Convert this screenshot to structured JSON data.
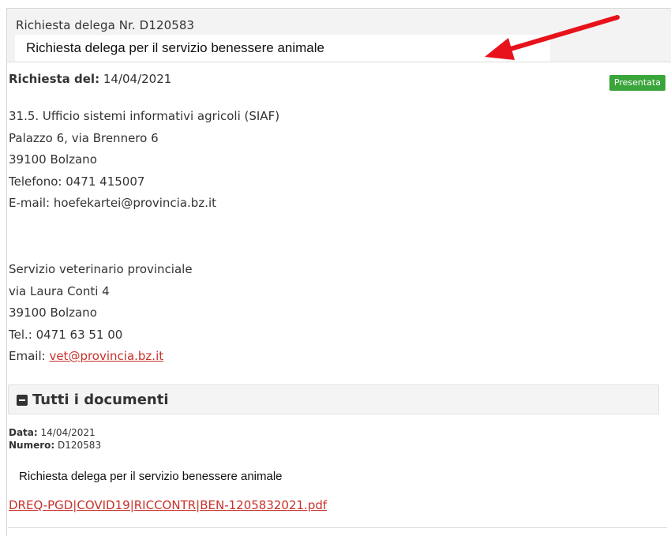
{
  "header": {
    "request_number": "Richiesta delega Nr. D120583",
    "overlay_label": "Richiesta delega per il servizio benessere animale"
  },
  "request": {
    "date_label": "Richiesta del:",
    "date_value": "14/04/2021",
    "status": "Presentata",
    "status_color": "#3aa53a"
  },
  "office1": {
    "lines": [
      "31.5. Ufficio sistemi informativi agricoli (SIAF)",
      "Palazzo 6, via Brennero 6",
      "39100 Bolzano",
      "Telefono: 0471 415007",
      "E-mail: hoefekartei@provincia.bz.it"
    ]
  },
  "office2": {
    "lines": [
      "Servizio veterinario provinciale",
      "via Laura Conti 4",
      "39100 Bolzano",
      "Tel.: 0471 63 51 00"
    ],
    "email_label": "Email:",
    "email_link": "vet@provincia.bz.it"
  },
  "documents": {
    "title": "Tutti i documenti",
    "date_label": "Data:",
    "date_value": "14/04/2021",
    "number_label": "Numero:",
    "number_value": "D120583",
    "description": "Richiesta delega per il servizio benessere animale",
    "file_name": "DREQ-PGD|COVID19|RICCONTR|BEN-1205832021.pdf"
  },
  "colors": {
    "link": "#c8312b",
    "arrow": "#e8121b"
  }
}
